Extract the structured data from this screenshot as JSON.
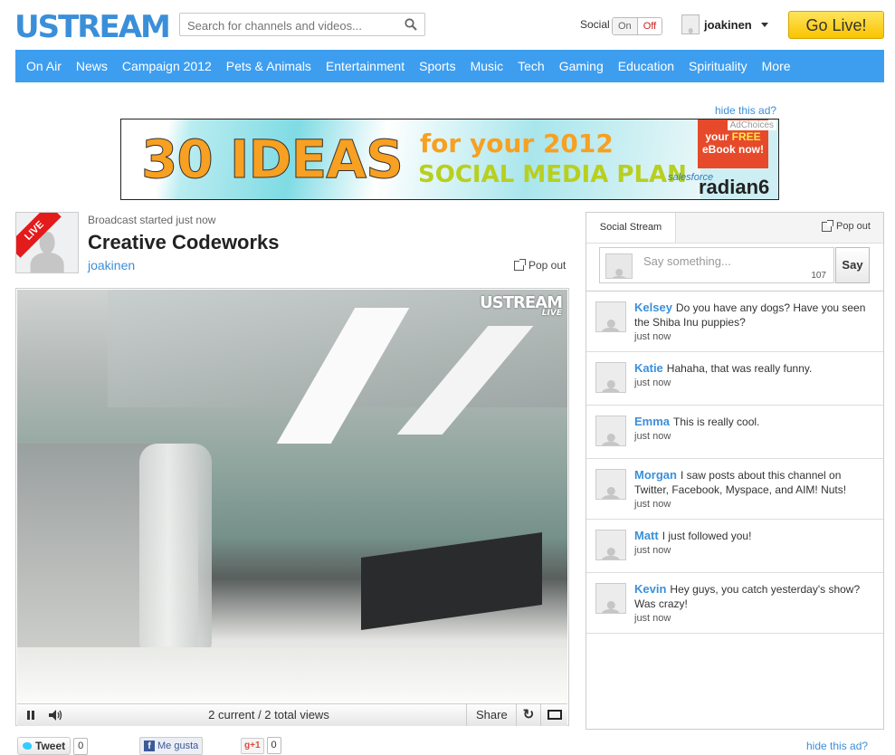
{
  "header": {
    "logo": "USTREAM",
    "search_placeholder": "Search for channels and videos...",
    "social_label": "Social",
    "toggle_on": "On",
    "toggle_off": "Off",
    "username": "joakinen",
    "go_live": "Go Live!"
  },
  "nav": [
    "On Air",
    "News",
    "Campaign 2012",
    "Pets & Animals",
    "Entertainment",
    "Sports",
    "Music",
    "Tech",
    "Gaming",
    "Education",
    "Spirituality",
    "More"
  ],
  "ad": {
    "hide_ad_top": "hide this ad?",
    "adchoices": "AdChoices",
    "big_text": "30 IDEAS",
    "line1": "for your 2012",
    "line2": "SOCIAL MEDIA PLAN",
    "ribbon_1": "your",
    "ribbon_free": "FREE",
    "ribbon_2": "eBook now!",
    "salesforce": "salesforce",
    "brand": "radian6",
    "hide_ad_bottom": "hide this ad?"
  },
  "channel": {
    "live_badge": "LIVE",
    "broadcast_status": "Broadcast started just now",
    "title": "Creative Codeworks",
    "owner": "joakinen",
    "popout": "Pop out"
  },
  "player": {
    "watermark": "USTREAM",
    "watermark_live": "LIVE",
    "views": "2 current / 2 total views",
    "share": "Share"
  },
  "social_buttons": {
    "tweet": "Tweet",
    "tweet_count": "0",
    "fb_like": "Me gusta",
    "gplus": "+1",
    "gplus_count": "0"
  },
  "stream": {
    "tab": "Social Stream",
    "popout": "Pop out",
    "placeholder": "Say something...",
    "char_count": "107",
    "say_button": "Say",
    "messages": [
      {
        "name": "Kelsey",
        "text": "Do you have any dogs? Have you seen the Shiba Inu puppies?",
        "time": "just now"
      },
      {
        "name": "Katie",
        "text": "Hahaha, that was really funny.",
        "time": "just now"
      },
      {
        "name": "Emma",
        "text": "This is really cool.",
        "time": "just now"
      },
      {
        "name": "Morgan",
        "text": "I saw posts about this channel on Twitter, Facebook, Myspace, and AIM! Nuts!",
        "time": "just now"
      },
      {
        "name": "Matt",
        "text": "I just followed you!",
        "time": "just now"
      },
      {
        "name": "Kevin",
        "text": "Hey guys, you catch yesterday's show? Was crazy!",
        "time": "just now"
      }
    ]
  }
}
